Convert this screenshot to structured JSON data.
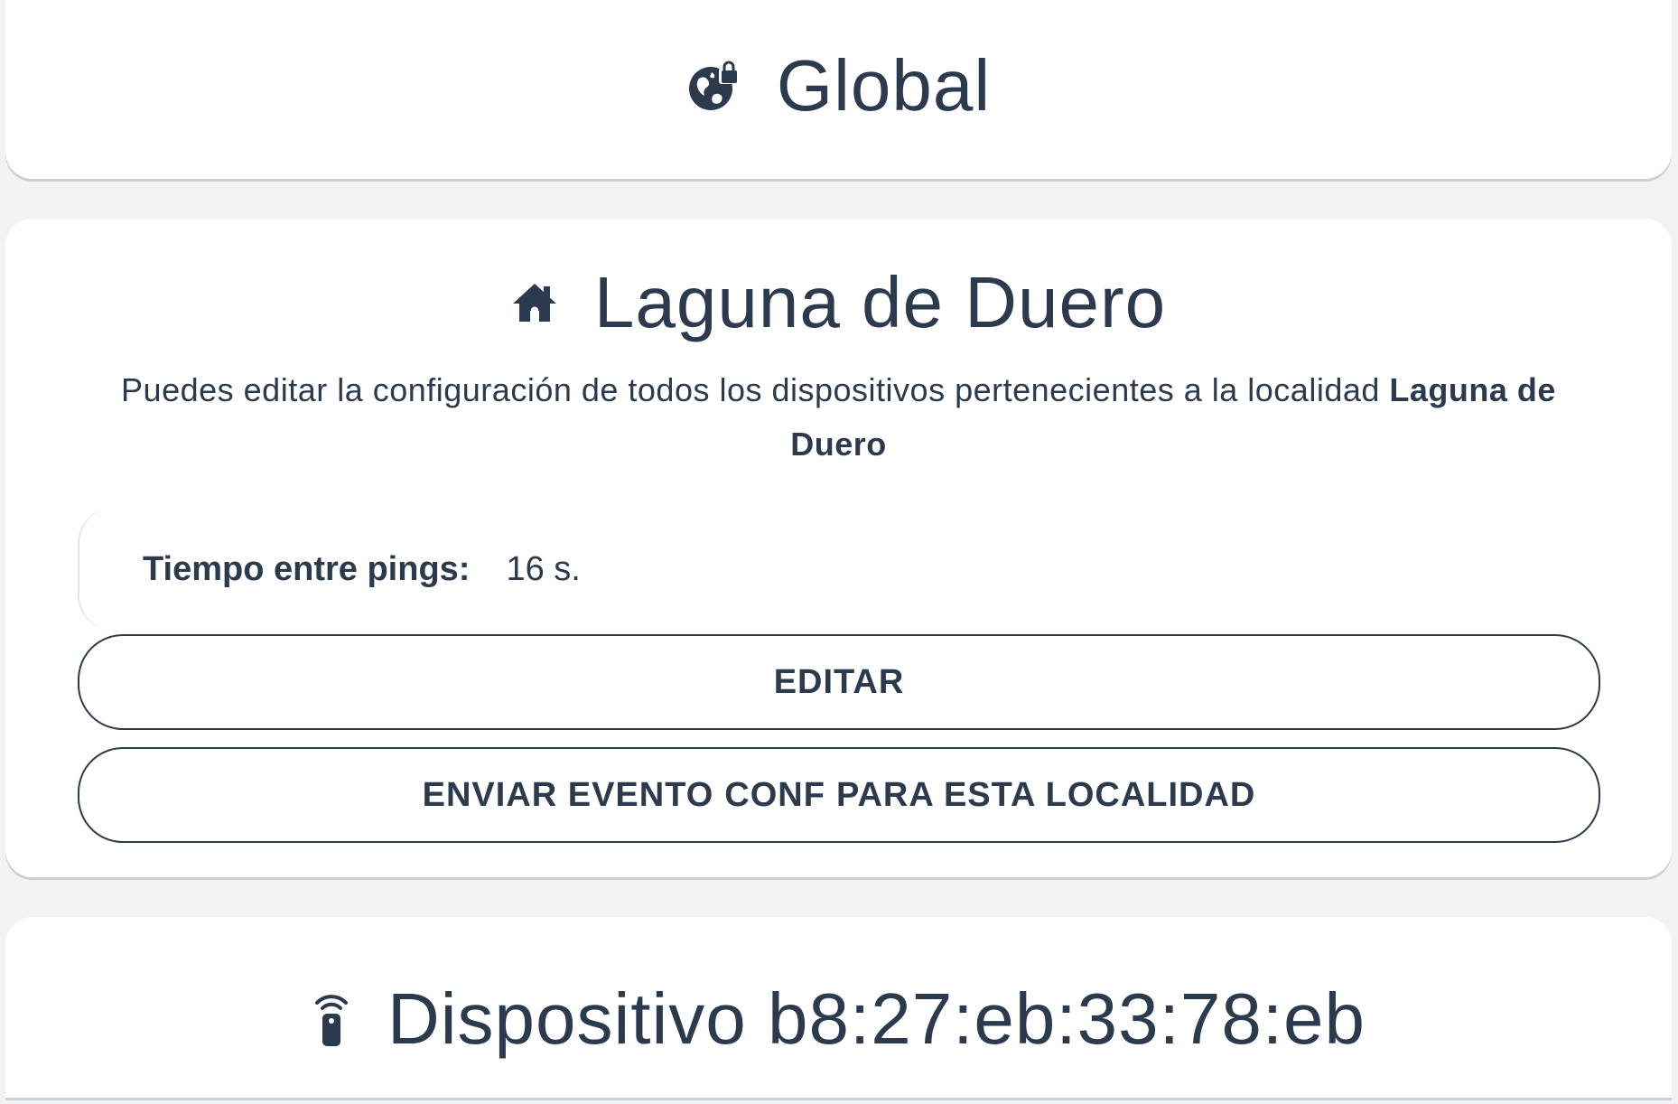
{
  "global": {
    "title": "Global",
    "icon": "globe-lock-icon"
  },
  "locality": {
    "title": "Laguna de Duero",
    "icon": "house-icon",
    "description_prefix": "Puedes editar la configuración de todos los dispositivos pertenecientes a la localidad",
    "description_name": "Laguna de Duero",
    "setting": {
      "label": "Tiempo entre pings:",
      "value": "16 s."
    },
    "edit_button": "EDITAR",
    "send_button": {
      "prefix": "ENVIAR EVENTO",
      "bold": "CONF",
      "suffix": "PARA ESTA LOCALIDAD"
    }
  },
  "device": {
    "title": "Dispositivo b8:27:eb:33:78:eb",
    "icon": "remote-signal-icon"
  },
  "colors": {
    "text": "#2c3a4d",
    "background": "#f2f2f2",
    "card": "#ffffff",
    "card_shadow": "#c9cfd9"
  }
}
